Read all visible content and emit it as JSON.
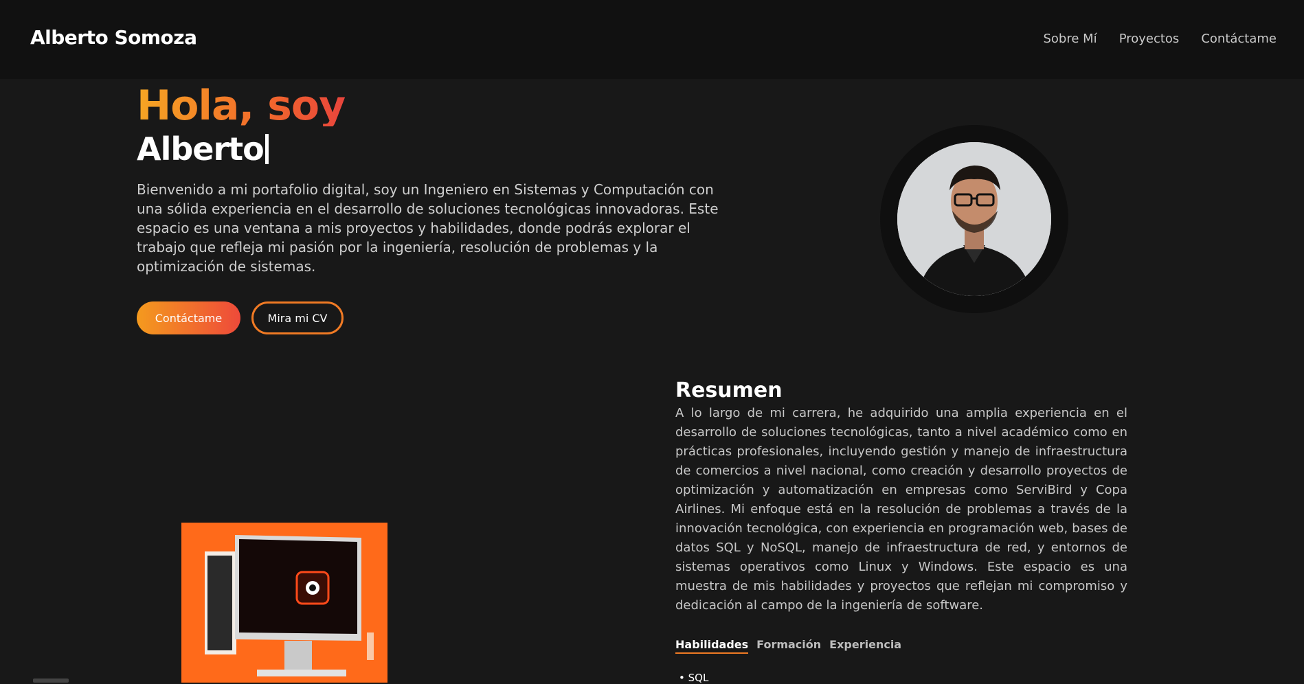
{
  "header": {
    "brand": "Alberto Somoza",
    "nav": [
      "Sobre Mí",
      "Proyectos",
      "Contáctame"
    ]
  },
  "hero": {
    "greeting": "Hola, soy",
    "name": "Alberto",
    "description": "Bienvenido a mi portafolio digital, soy un Ingeniero en Sistemas y Computación con una sólida experiencia en el desarrollo de soluciones tecnológicas innovadoras. Este espacio es una ventana a mis proyectos y habilidades, donde podrás explorar el trabajo que refleja mi pasión por la ingeniería, resolución de problemas y la optimización de sistemas.",
    "buttons": {
      "primary": "Contáctame",
      "secondary": "Mira mi CV"
    }
  },
  "summary": {
    "title": "Resumen",
    "text": "A lo largo de mi carrera, he adquirido una amplia experiencia en el desarrollo de soluciones tecnológicas, tanto a nivel académico como en prácticas profesionales, incluyendo gestión y manejo de infraestructura de comercios a nivel nacional, como creación y desarrollo proyectos de optimización y automatización en empresas como ServiBird y Copa Airlines. Mi enfoque está en la resolución de problemas a través de la innovación tecnológica, con experiencia en programación web, bases de datos SQL y NoSQL, manejo de infraestructura de red, y entornos de sistemas operativos como Linux y Windows. Este espacio es una muestra de mis habilidades y proyectos que reflejan mi compromiso y dedicación al campo de la ingeniería de software.",
    "tabs": [
      "Habilidades",
      "Formación",
      "Experiencia"
    ],
    "active_tab": "Habilidades",
    "skills": [
      "SQL"
    ]
  },
  "colors": {
    "background": "#181818",
    "header": "#111111",
    "accent_start": "#f49a1e",
    "accent_end": "#ee4a3a"
  }
}
